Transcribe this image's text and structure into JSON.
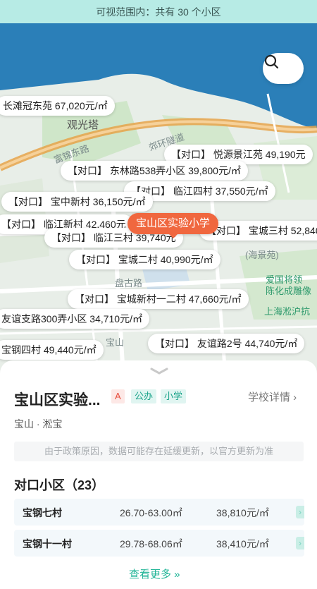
{
  "topbar": {
    "visible_count_text": "可视范围内：共有 30 个小区"
  },
  "map": {
    "place_labels": [
      {
        "text": "观光塔"
      },
      {
        "text": "富锦东路"
      },
      {
        "text": "郊环隧道"
      },
      {
        "text": "盘古路"
      },
      {
        "text": "上海淞沪抗"
      },
      {
        "text": "爱国将领"
      },
      {
        "text": "陈化成雕像"
      },
      {
        "text": "(海景苑)"
      },
      {
        "text": "宝山"
      }
    ],
    "school_marker": "宝山区实验小学",
    "listings": [
      {
        "text": "长滩冠东苑 67,020元/㎡"
      },
      {
        "text": "【对口】 悦源景江苑 49,190元"
      },
      {
        "text": "【对口】 东林路538弄小区 39,800元/㎡"
      },
      {
        "text": "【对口】 临江四村 37,550元/㎡"
      },
      {
        "text": "【对口】 宝中新村 36,150元/㎡"
      },
      {
        "text": "【对口】 临江新村 42,460元"
      },
      {
        "text": "【对口】 临江三村 39,740元"
      },
      {
        "text": "【对口】 宝城三村 52,840"
      },
      {
        "text": "【对口】 宝城二村 40,990元/㎡"
      },
      {
        "text": "【对口】 宝城新村一二村 47,660元/㎡"
      },
      {
        "text": "友谊支路300弄小区 34,710元/㎡"
      },
      {
        "text": "宝钢四村 49,440元/㎡"
      },
      {
        "text": "【对口】 友谊路2号 44,740元/㎡"
      }
    ]
  },
  "school": {
    "name": "宝山区实验...",
    "badges": [
      "A",
      "公办",
      "小学"
    ],
    "detail_link": "学校详情 ›",
    "district": "宝山 · 淞宝",
    "notice": "由于政策原因，数据可能存在延缓更新，以官方更新为准"
  },
  "matched": {
    "title": "对口小区（23）",
    "rows": [
      {
        "name": "宝钢七村",
        "area": "26.70-63.00㎡",
        "price": "38,810元/㎡"
      },
      {
        "name": "宝钢十一村",
        "area": "29.78-68.06㎡",
        "price": "38,410元/㎡"
      }
    ],
    "more_label": "查看更多 »"
  },
  "colors": {
    "accent": "#21b597",
    "marker": "#f0673f",
    "water": "#2b7fb8",
    "topbar": "#b7ebe5"
  },
  "icons": {
    "search": "search-icon",
    "handle": "chevron-down-icon",
    "row_arrow": "chevron-right-icon"
  }
}
